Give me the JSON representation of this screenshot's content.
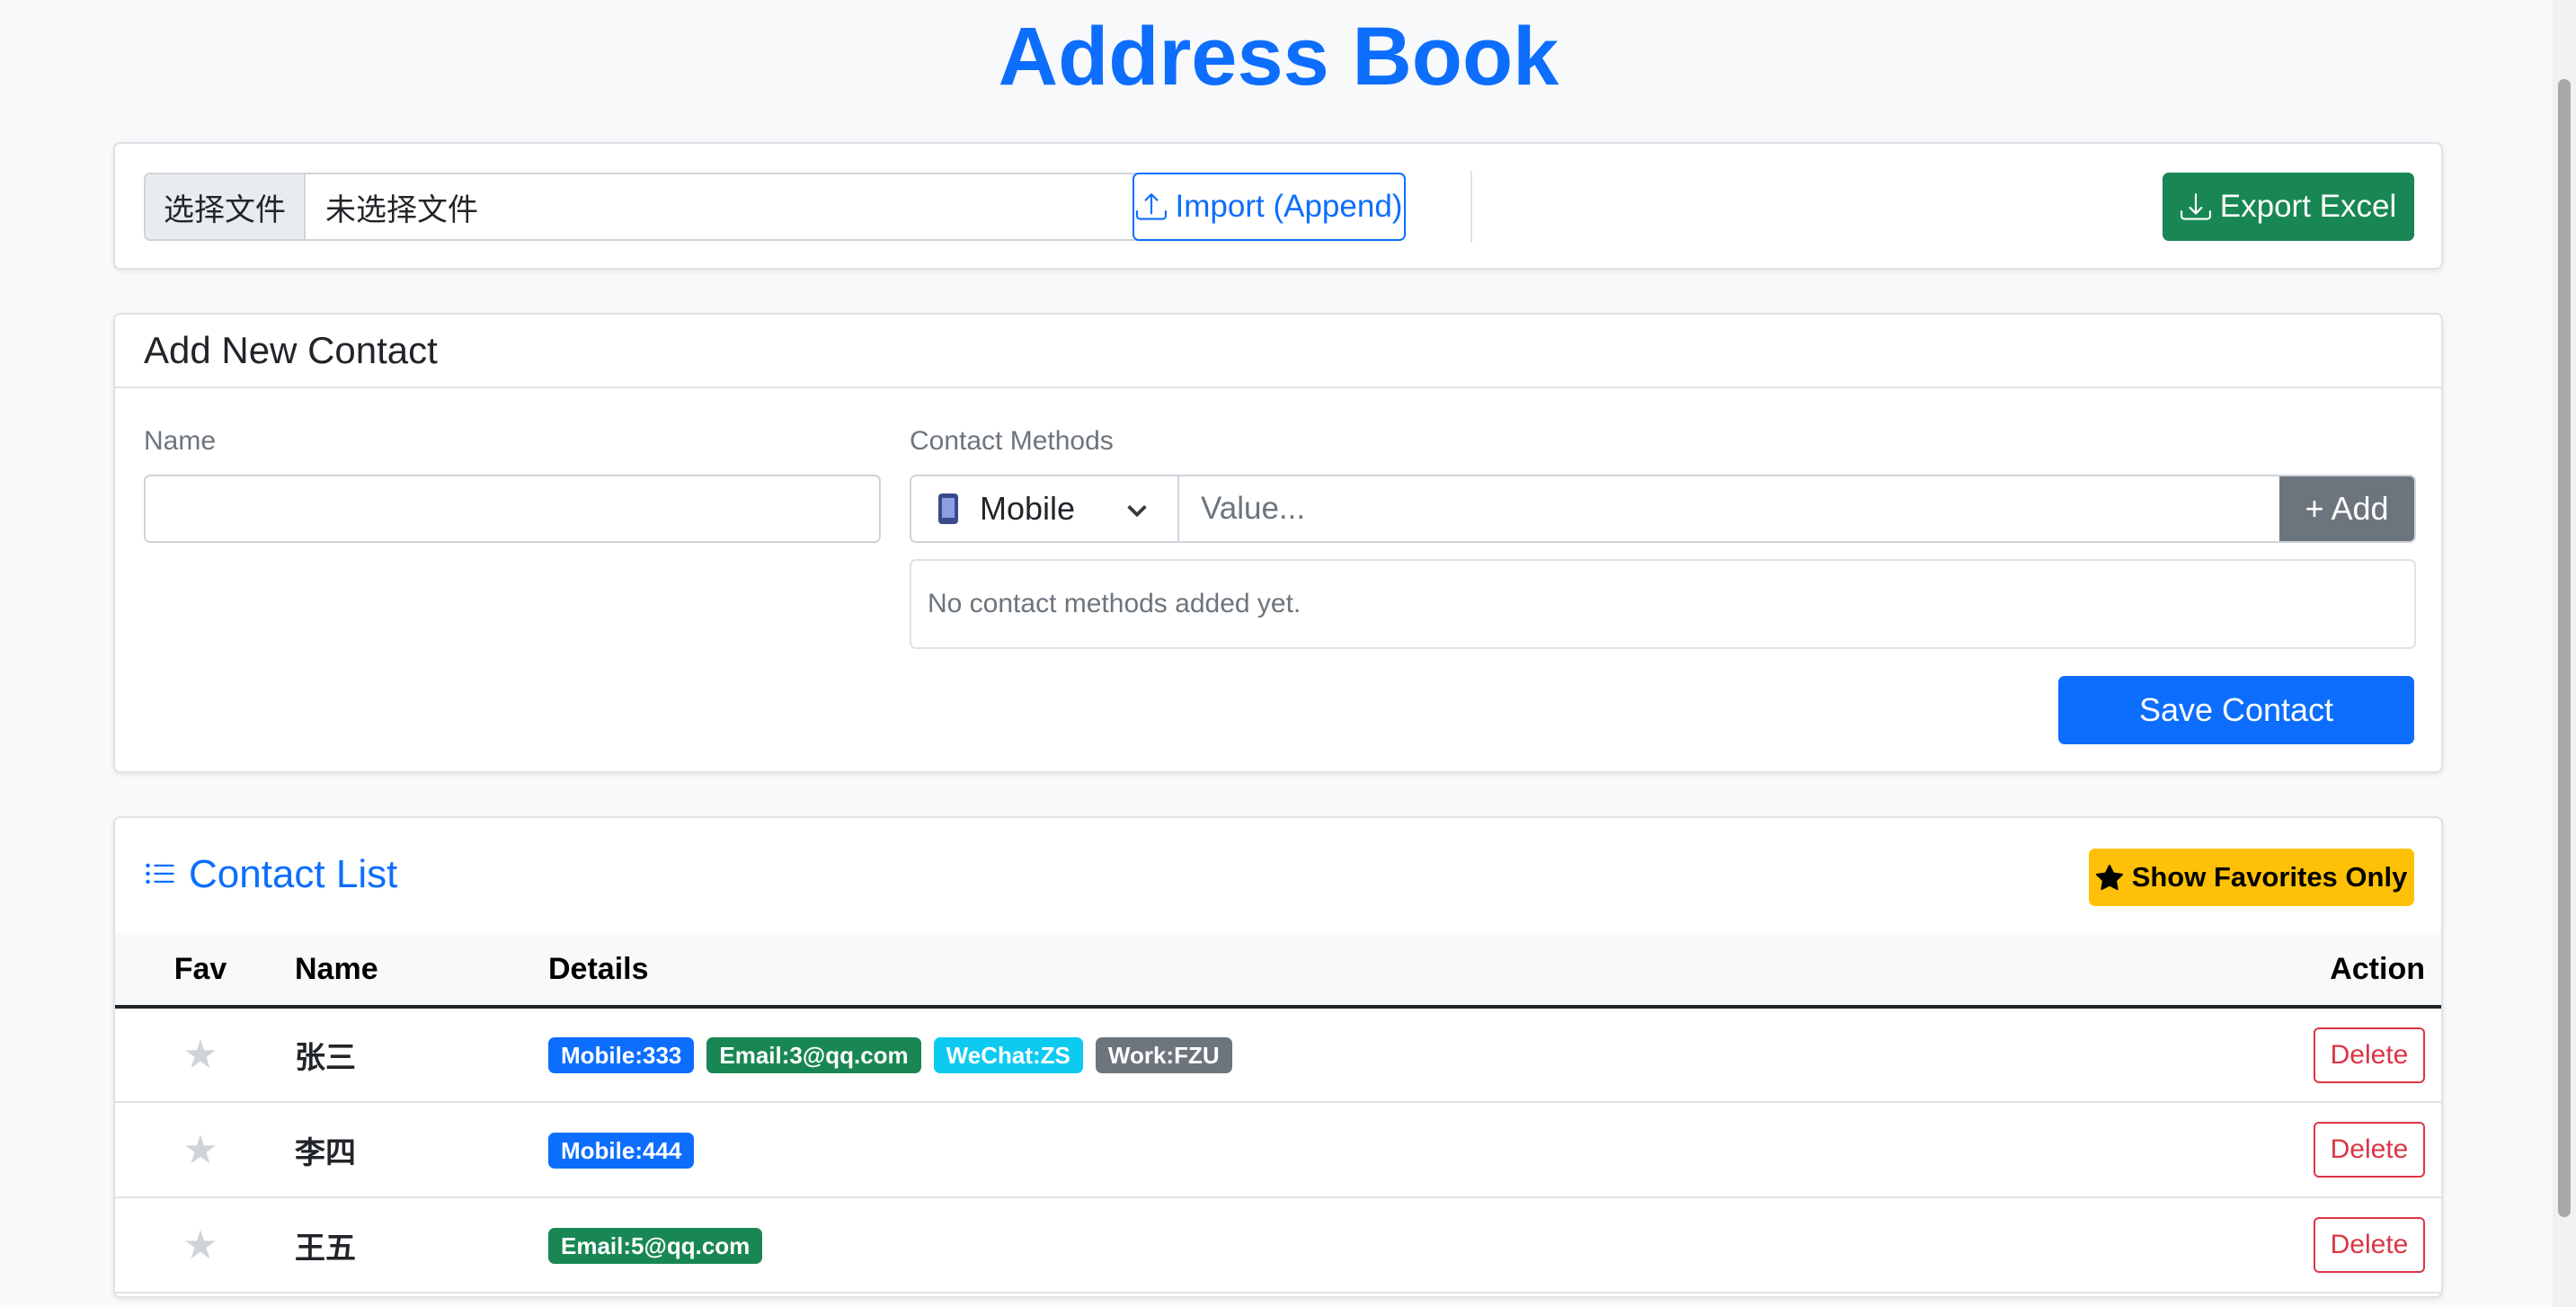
{
  "header": {
    "title": "Address Book"
  },
  "io": {
    "file_button": "选择文件",
    "file_name": "未选择文件",
    "import_label": "Import (Append)",
    "export_label": "Export Excel"
  },
  "add_contact": {
    "title": "Add New Contact",
    "name_label": "Name",
    "name_value": "",
    "methods_label": "Contact Methods",
    "method_selected": "Mobile",
    "value_placeholder": "Value...",
    "add_label": "+ Add",
    "empty_message": "No contact methods added yet.",
    "save_label": "Save Contact"
  },
  "contact_list": {
    "title": "Contact List",
    "favorites_label": "Show Favorites Only",
    "columns": {
      "fav": "Fav",
      "name": "Name",
      "details": "Details",
      "action": "Action"
    },
    "rows": [
      {
        "fav_icon": "★",
        "name": "张三",
        "badges": [
          {
            "text": "Mobile:333",
            "color": "#0d6efd"
          },
          {
            "text": "Email:3@qq.com",
            "color": "#198754"
          },
          {
            "text": "WeChat:ZS",
            "color": "#0dcaf0"
          },
          {
            "text": "Work:FZU",
            "color": "#6c757d"
          }
        ],
        "action": "Delete"
      },
      {
        "fav_icon": "★",
        "name": "李四",
        "badges": [
          {
            "text": "Mobile:444",
            "color": "#0d6efd"
          }
        ],
        "action": "Delete"
      },
      {
        "fav_icon": "★",
        "name": "王五",
        "badges": [
          {
            "text": "Email:5@qq.com",
            "color": "#198754"
          }
        ],
        "action": "Delete"
      }
    ]
  },
  "colors": {
    "primary": "#0d6efd",
    "success": "#198754",
    "warning": "#ffc107",
    "danger": "#dc3545",
    "secondary": "#6c757d",
    "info": "#0dcaf0"
  }
}
